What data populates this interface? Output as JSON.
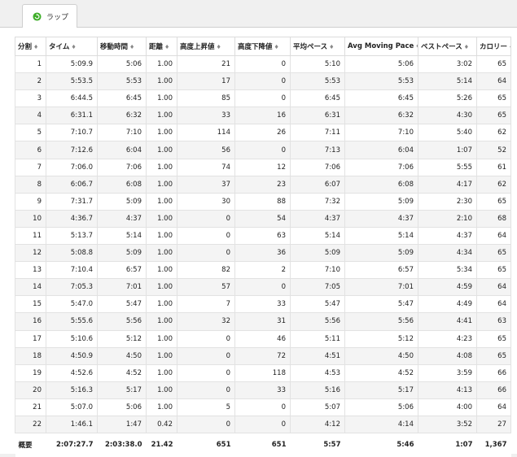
{
  "tab": {
    "label": "ラップ"
  },
  "table": {
    "columns": [
      "分割",
      "タイム",
      "移動時間",
      "距離",
      "高度上昇値",
      "高度下降値",
      "平均ペース",
      "Avg Moving Pace",
      "ベストペース",
      "カロリー"
    ],
    "sort_glyph": "♦",
    "rows": [
      [
        "1",
        "5:09.9",
        "5:06",
        "1.00",
        "21",
        "0",
        "5:10",
        "5:06",
        "3:02",
        "65"
      ],
      [
        "2",
        "5:53.5",
        "5:53",
        "1.00",
        "17",
        "0",
        "5:53",
        "5:53",
        "5:14",
        "64"
      ],
      [
        "3",
        "6:44.5",
        "6:45",
        "1.00",
        "85",
        "0",
        "6:45",
        "6:45",
        "5:26",
        "65"
      ],
      [
        "4",
        "6:31.1",
        "6:32",
        "1.00",
        "33",
        "16",
        "6:31",
        "6:32",
        "4:30",
        "65"
      ],
      [
        "5",
        "7:10.7",
        "7:10",
        "1.00",
        "114",
        "26",
        "7:11",
        "7:10",
        "5:40",
        "62"
      ],
      [
        "6",
        "7:12.6",
        "6:04",
        "1.00",
        "56",
        "0",
        "7:13",
        "6:04",
        "1:07",
        "52"
      ],
      [
        "7",
        "7:06.0",
        "7:06",
        "1.00",
        "74",
        "12",
        "7:06",
        "7:06",
        "5:55",
        "61"
      ],
      [
        "8",
        "6:06.7",
        "6:08",
        "1.00",
        "37",
        "23",
        "6:07",
        "6:08",
        "4:17",
        "62"
      ],
      [
        "9",
        "7:31.7",
        "5:09",
        "1.00",
        "30",
        "88",
        "7:32",
        "5:09",
        "2:30",
        "65"
      ],
      [
        "10",
        "4:36.7",
        "4:37",
        "1.00",
        "0",
        "54",
        "4:37",
        "4:37",
        "2:10",
        "68"
      ],
      [
        "11",
        "5:13.7",
        "5:14",
        "1.00",
        "0",
        "63",
        "5:14",
        "5:14",
        "4:37",
        "64"
      ],
      [
        "12",
        "5:08.8",
        "5:09",
        "1.00",
        "0",
        "36",
        "5:09",
        "5:09",
        "4:34",
        "65"
      ],
      [
        "13",
        "7:10.4",
        "6:57",
        "1.00",
        "82",
        "2",
        "7:10",
        "6:57",
        "5:34",
        "65"
      ],
      [
        "14",
        "7:05.3",
        "7:01",
        "1.00",
        "57",
        "0",
        "7:05",
        "7:01",
        "4:59",
        "64"
      ],
      [
        "15",
        "5:47.0",
        "5:47",
        "1.00",
        "7",
        "33",
        "5:47",
        "5:47",
        "4:49",
        "64"
      ],
      [
        "16",
        "5:55.6",
        "5:56",
        "1.00",
        "32",
        "31",
        "5:56",
        "5:56",
        "4:41",
        "63"
      ],
      [
        "17",
        "5:10.6",
        "5:12",
        "1.00",
        "0",
        "46",
        "5:11",
        "5:12",
        "4:23",
        "65"
      ],
      [
        "18",
        "4:50.9",
        "4:50",
        "1.00",
        "0",
        "72",
        "4:51",
        "4:50",
        "4:08",
        "65"
      ],
      [
        "19",
        "4:52.6",
        "4:52",
        "1.00",
        "0",
        "118",
        "4:53",
        "4:52",
        "3:59",
        "66"
      ],
      [
        "20",
        "5:16.3",
        "5:17",
        "1.00",
        "0",
        "33",
        "5:16",
        "5:17",
        "4:13",
        "66"
      ],
      [
        "21",
        "5:07.0",
        "5:06",
        "1.00",
        "5",
        "0",
        "5:07",
        "5:06",
        "4:00",
        "64"
      ],
      [
        "22",
        "1:46.1",
        "1:47",
        "0.42",
        "0",
        "0",
        "4:12",
        "4:14",
        "3:52",
        "27"
      ]
    ],
    "summary": [
      "概要",
      "2:07:27.7",
      "2:03:38.0",
      "21.42",
      "651",
      "651",
      "5:57",
      "5:46",
      "1:07",
      "1,367"
    ]
  },
  "colors": {
    "tab_icon": "#3fae2a",
    "stripe": "#f4f4f4",
    "border": "#dcdcdc"
  }
}
